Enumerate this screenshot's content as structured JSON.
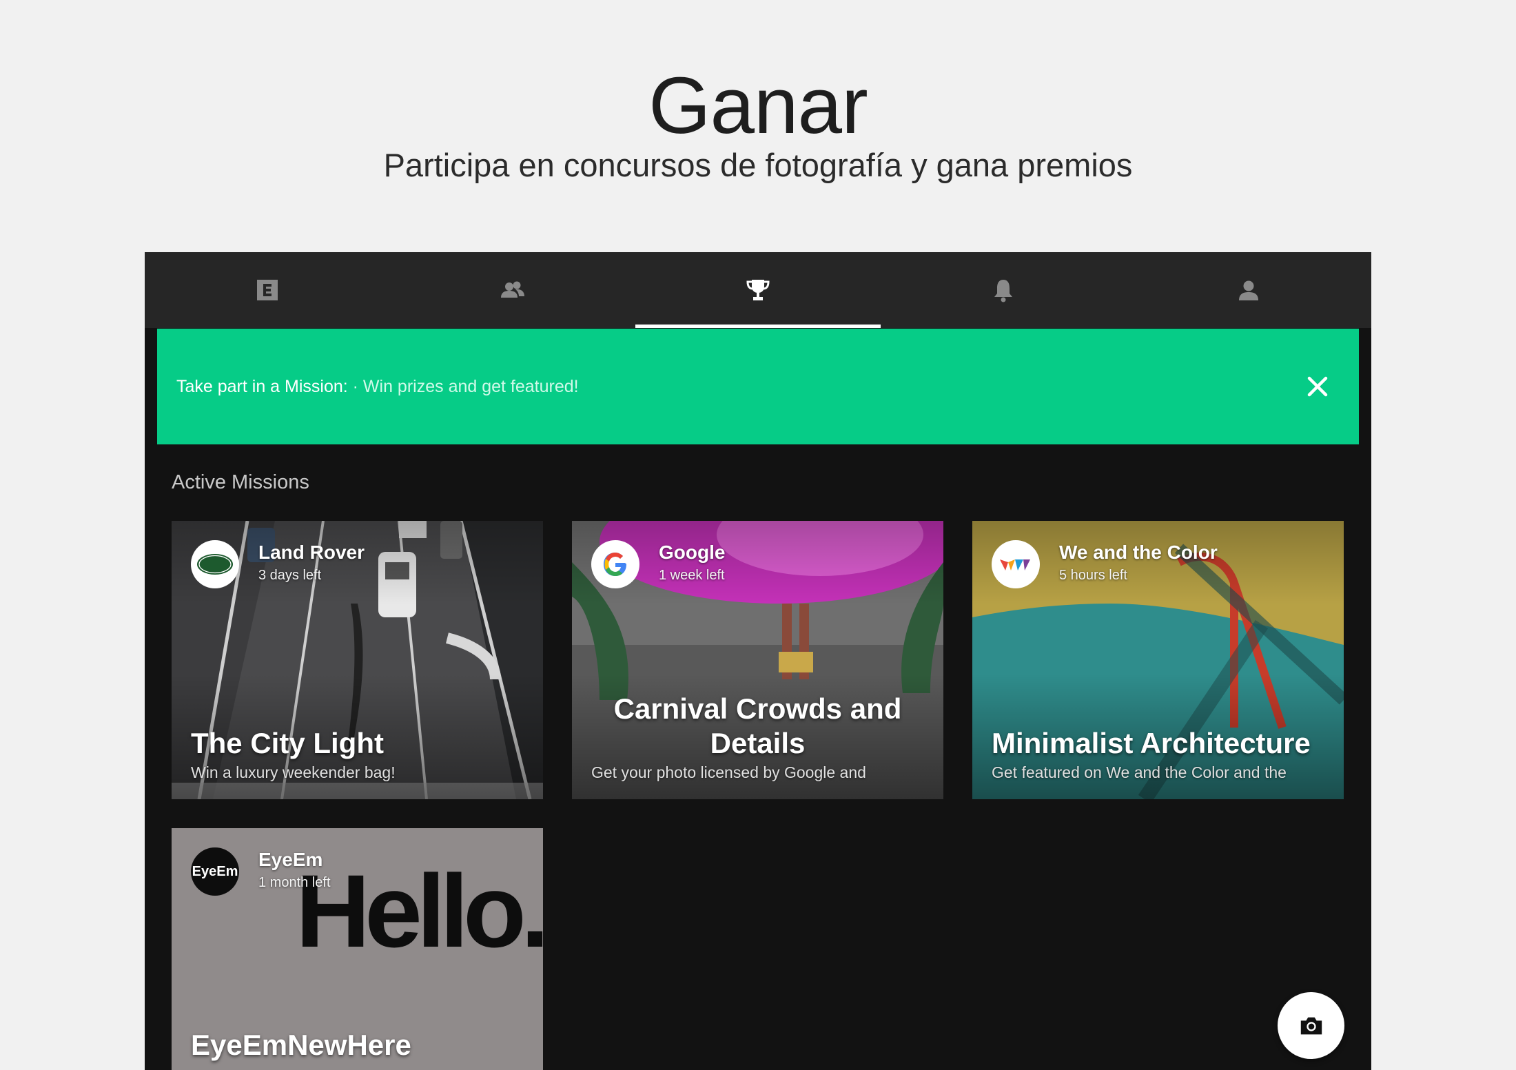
{
  "header": {
    "title": "Ganar",
    "subtitle": "Participa en concursos de fotografía y gana premios"
  },
  "tabs": [
    {
      "icon": "eyeem-logo-icon",
      "active": false
    },
    {
      "icon": "people-icon",
      "active": false
    },
    {
      "icon": "trophy-icon",
      "active": true
    },
    {
      "icon": "bell-icon",
      "active": false
    },
    {
      "icon": "person-icon",
      "active": false
    }
  ],
  "banner": {
    "label": "Take part in a Mission:",
    "text": " · Win prizes and get featured!",
    "color": "#06cc87",
    "close_icon": "close-icon"
  },
  "section": {
    "title": "Active Missions"
  },
  "missions": [
    {
      "brand": "Land Rover",
      "time_left": "3 days left",
      "title": "The City Light",
      "description": "Win a luxury weekender bag!",
      "logo_text": "LAND ROVER"
    },
    {
      "brand": "Google",
      "time_left": "1 week left",
      "title": "Carnival Crowds and Details",
      "description": "Get your photo licensed by Google and",
      "logo_text": "G"
    },
    {
      "brand": "We and the Color",
      "time_left": "5 hours left",
      "title": "Minimalist Architecture",
      "description": "Get featured on We and the Color and the",
      "logo_text": "WAC"
    },
    {
      "brand": "EyeEm",
      "time_left": "1 month left",
      "title": "EyeEmNewHere",
      "logo_text": "EyeEm",
      "image_text": "Hello."
    }
  ],
  "fab": {
    "icon": "camera-icon"
  }
}
